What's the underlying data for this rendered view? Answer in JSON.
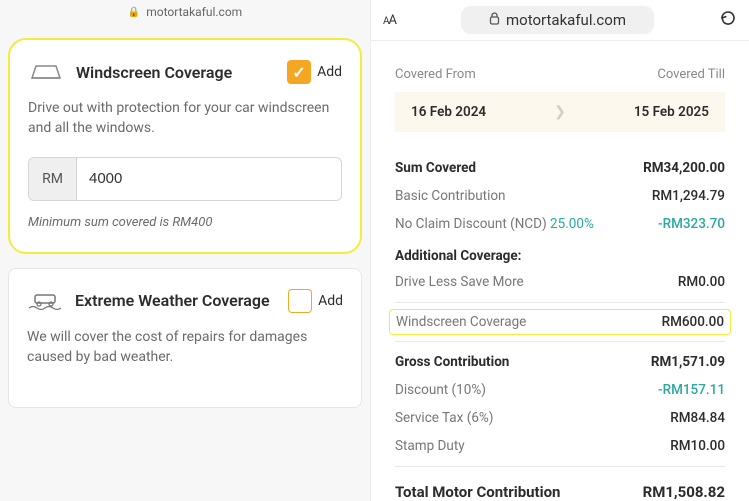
{
  "leftAddressBar": {
    "domain": "motortakaful.com"
  },
  "cards": {
    "windscreen": {
      "title": "Windscreen Coverage",
      "addLabel": "Add",
      "checked": true,
      "desc": "Drive out with protection for your car windscreen and all the windows.",
      "currencyPrefix": "RM",
      "amount": "4000",
      "note": "Minimum sum covered is RM400"
    },
    "weather": {
      "title": "Extreme Weather Coverage",
      "addLabel": "Add",
      "checked": false,
      "desc": "We will cover the cost of repairs for damages caused by bad weather."
    }
  },
  "browser": {
    "domain": "motortakaful.com"
  },
  "coverage": {
    "fromLabel": "Covered From",
    "tillLabel": "Covered Till",
    "fromDate": "16 Feb 2024",
    "tillDate": "15 Feb 2025"
  },
  "summary": {
    "sumCovered": {
      "label": "Sum Covered",
      "value": "RM34,200.00"
    },
    "basic": {
      "label": "Basic Contribution",
      "value": "RM1,294.79"
    },
    "ncd": {
      "labelPrefix": "No Claim Discount (NCD) ",
      "percent": "25.00%",
      "value": "-RM323.70"
    },
    "additionalHead": "Additional Coverage:",
    "driveLess": {
      "label": "Drive Less Save More",
      "value": "RM0.00"
    },
    "windscreen": {
      "label": "Windscreen Coverage",
      "value": "RM600.00"
    },
    "gross": {
      "label": "Gross Contribution",
      "value": "RM1,571.09"
    },
    "discount": {
      "label": "Discount (10%)",
      "value": "-RM157.11"
    },
    "serviceTax": {
      "label": "Service Tax (6%)",
      "value": "RM84.84"
    },
    "stampDuty": {
      "label": "Stamp Duty",
      "value": "RM10.00"
    },
    "total": {
      "label": "Total Motor Contribution",
      "value": "RM1,508.82"
    }
  }
}
